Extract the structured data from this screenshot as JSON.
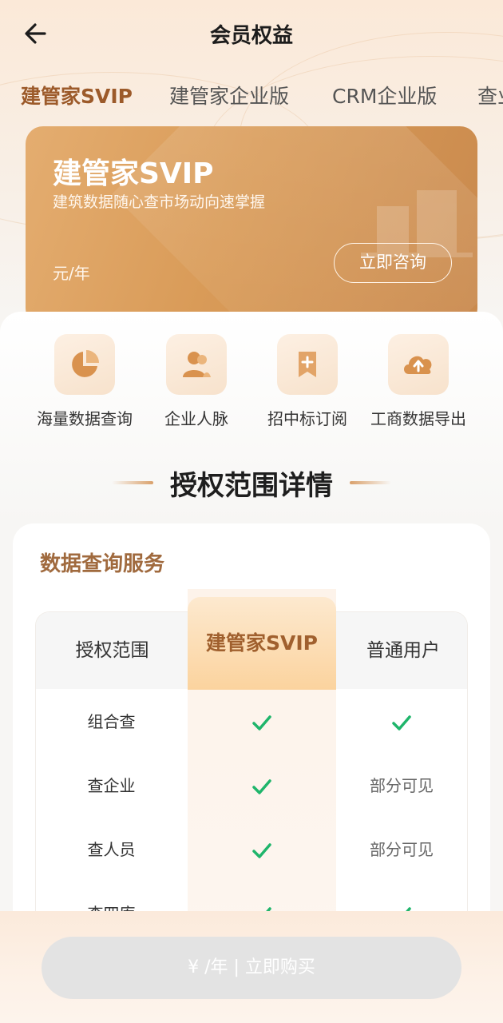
{
  "header": {
    "title": "会员权益"
  },
  "tabs": [
    {
      "label": "建管家SVIP",
      "active": true
    },
    {
      "label": "建管家企业版",
      "active": false
    },
    {
      "label": "CRM企业版",
      "active": false
    },
    {
      "label": "查业",
      "active": false
    }
  ],
  "hero": {
    "name": "建管家SVIP",
    "subtitle": "建筑数据随心查市场动向速掌握",
    "price": "元/年",
    "consult_label": "立即咨询"
  },
  "features": [
    {
      "label": "海量数据查询",
      "icon": "pie-chart-icon"
    },
    {
      "label": "企业人脉",
      "icon": "people-icon"
    },
    {
      "label": "招中标订阅",
      "icon": "bookmark-plus-icon"
    },
    {
      "label": "工商数据导出",
      "icon": "cloud-upload-icon"
    }
  ],
  "section": {
    "title": "授权范围详情"
  },
  "card": {
    "title": "数据查询服务",
    "headers": [
      "授权范围",
      "建管家SVIP",
      "普通用户"
    ],
    "rows": [
      {
        "name": "组合查",
        "svip": "check",
        "normal": "check",
        "normal_text": ""
      },
      {
        "name": "查企业",
        "svip": "check",
        "normal": "text",
        "normal_text": "部分可见"
      },
      {
        "name": "查人员",
        "svip": "check",
        "normal": "text",
        "normal_text": "部分可见"
      },
      {
        "name": "查四库",
        "svip": "check",
        "normal": "check",
        "normal_text": ""
      }
    ]
  },
  "bottom": {
    "buy_label": "¥ /年 | 立即购买"
  },
  "colors": {
    "accent": "#9c5a2a",
    "check": "#1fb56b",
    "hero": "#d99b58"
  }
}
